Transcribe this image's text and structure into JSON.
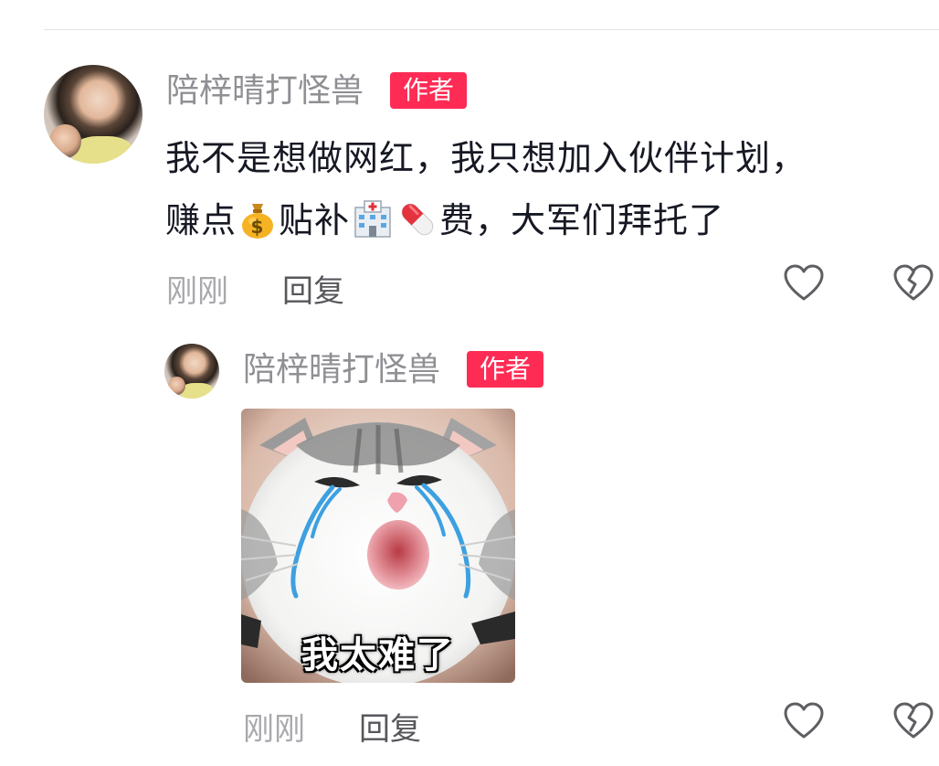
{
  "comments": [
    {
      "username": "陪梓晴打怪兽",
      "badge": "作者",
      "text_line1": "我不是想做网红，我只想加入伙伴计划，",
      "text_line2_a": "赚点",
      "emoji_1": "money-bag",
      "text_line2_b": "贴补",
      "emoji_2": "hospital",
      "emoji_3": "pill",
      "text_line2_c": "费，大军们拜托了",
      "time": "刚刚",
      "reply_label": "回复"
    }
  ],
  "replies": [
    {
      "username": "陪梓晴打怪兽",
      "badge": "作者",
      "sticker_caption": "我太难了",
      "time": "刚刚",
      "reply_label": "回复"
    }
  ],
  "colors": {
    "badge": "#fe2c55",
    "username": "#8f8f94",
    "text": "#161823"
  }
}
